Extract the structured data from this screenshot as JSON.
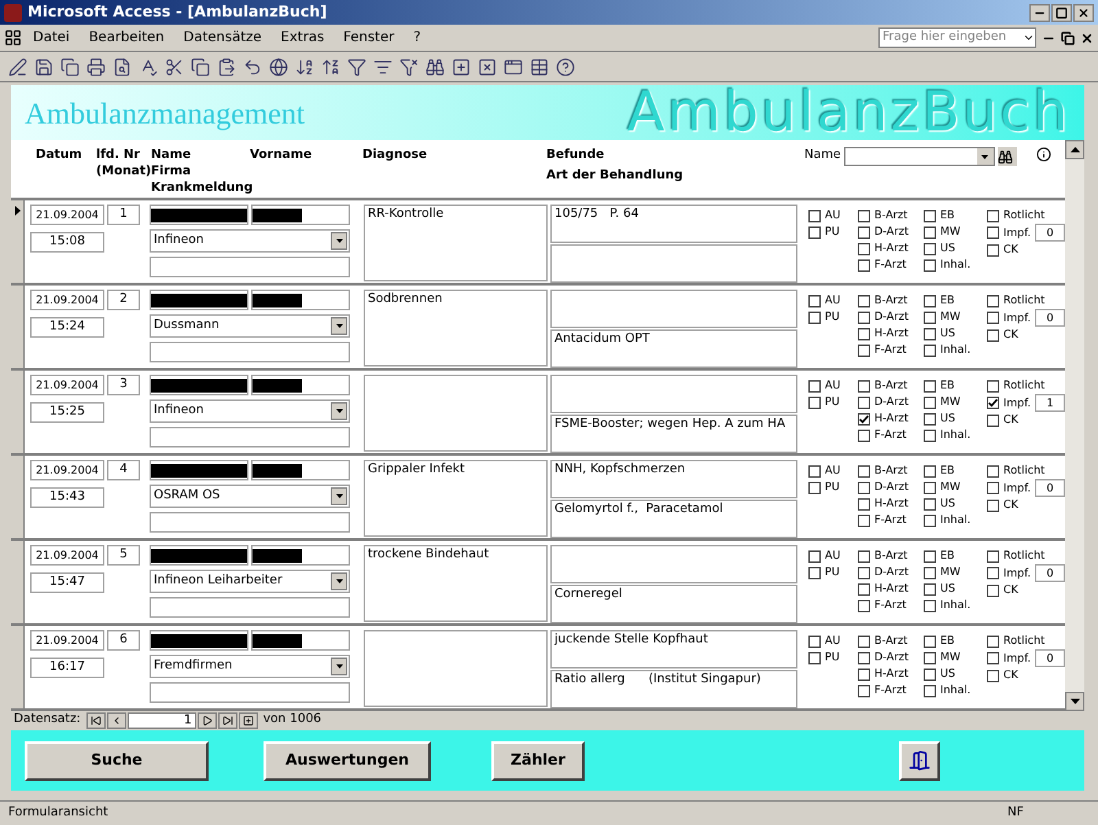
{
  "window": {
    "title": "Microsoft Access - [AmbulanzBuch]"
  },
  "menu": {
    "items": [
      "Datei",
      "Bearbeiten",
      "Datensätze",
      "Extras",
      "Fenster",
      "?"
    ],
    "help_placeholder": "Frage hier eingeben"
  },
  "form": {
    "heading": "Ambulanzmanagement",
    "logo_text": "AmbulanzBuch",
    "columns": {
      "datum": "Datum",
      "nr": "lfd. Nr",
      "nr_sub": "(Monat)",
      "name": "Name",
      "firma": "Firma",
      "krank": "Krankmeldung",
      "vorname": "Vorname",
      "diagnose": "Diagnose",
      "befunde": "Befunde",
      "behandlung": "Art der Behandlung"
    },
    "search_label": "Name",
    "rows": [
      {
        "current": true,
        "date": "21.09.2004",
        "nr": "1",
        "time": "15:08",
        "firma": "Infineon",
        "diagnose": "RR-Kontrolle",
        "befund": "105/75   P. 64",
        "behandlung": "",
        "impf": "0",
        "checks": [
          {
            "label": "AU",
            "checked": false
          },
          {
            "label": "PU",
            "checked": false
          },
          {
            "label": "B-Arzt",
            "checked": false
          },
          {
            "label": "D-Arzt",
            "checked": false
          },
          {
            "label": "H-Arzt",
            "checked": false
          },
          {
            "label": "F-Arzt",
            "checked": false
          },
          {
            "label": "EB",
            "checked": false
          },
          {
            "label": "MW",
            "checked": false
          },
          {
            "label": "US",
            "checked": false
          },
          {
            "label": "Inhal.",
            "checked": false
          },
          {
            "label": "Rotlicht",
            "checked": false
          },
          {
            "label": "Impf.",
            "checked": false
          },
          {
            "label": "CK",
            "checked": false
          }
        ]
      },
      {
        "current": false,
        "date": "21.09.2004",
        "nr": "2",
        "time": "15:24",
        "firma": "Dussmann",
        "diagnose": "Sodbrennen",
        "befund": "",
        "behandlung": "Antacidum OPT",
        "impf": "0",
        "checks": [
          {
            "label": "AU",
            "checked": false
          },
          {
            "label": "PU",
            "checked": false
          },
          {
            "label": "B-Arzt",
            "checked": false
          },
          {
            "label": "D-Arzt",
            "checked": false
          },
          {
            "label": "H-Arzt",
            "checked": false
          },
          {
            "label": "F-Arzt",
            "checked": false
          },
          {
            "label": "EB",
            "checked": false
          },
          {
            "label": "MW",
            "checked": false
          },
          {
            "label": "US",
            "checked": false
          },
          {
            "label": "Inhal.",
            "checked": false
          },
          {
            "label": "Rotlicht",
            "checked": false
          },
          {
            "label": "Impf.",
            "checked": false
          },
          {
            "label": "CK",
            "checked": false
          }
        ]
      },
      {
        "current": false,
        "date": "21.09.2004",
        "nr": "3",
        "time": "15:25",
        "firma": "Infineon",
        "diagnose": "",
        "befund": "",
        "behandlung": "FSME-Booster; wegen Hep. A zum HA",
        "impf": "1",
        "checks": [
          {
            "label": "AU",
            "checked": false
          },
          {
            "label": "PU",
            "checked": false
          },
          {
            "label": "B-Arzt",
            "checked": false
          },
          {
            "label": "D-Arzt",
            "checked": false
          },
          {
            "label": "H-Arzt",
            "checked": true
          },
          {
            "label": "F-Arzt",
            "checked": false
          },
          {
            "label": "EB",
            "checked": false
          },
          {
            "label": "MW",
            "checked": false
          },
          {
            "label": "US",
            "checked": false
          },
          {
            "label": "Inhal.",
            "checked": false
          },
          {
            "label": "Rotlicht",
            "checked": false
          },
          {
            "label": "Impf.",
            "checked": true
          },
          {
            "label": "CK",
            "checked": false
          }
        ]
      },
      {
        "current": false,
        "date": "21.09.2004",
        "nr": "4",
        "time": "15:43",
        "firma": "OSRAM OS",
        "diagnose": "Grippaler Infekt",
        "befund": "NNH, Kopfschmerzen",
        "behandlung": "Gelomyrtol f.,  Paracetamol",
        "impf": "0",
        "checks": [
          {
            "label": "AU",
            "checked": false
          },
          {
            "label": "PU",
            "checked": false
          },
          {
            "label": "B-Arzt",
            "checked": false
          },
          {
            "label": "D-Arzt",
            "checked": false
          },
          {
            "label": "H-Arzt",
            "checked": false
          },
          {
            "label": "F-Arzt",
            "checked": false
          },
          {
            "label": "EB",
            "checked": false
          },
          {
            "label": "MW",
            "checked": false
          },
          {
            "label": "US",
            "checked": false
          },
          {
            "label": "Inhal.",
            "checked": false
          },
          {
            "label": "Rotlicht",
            "checked": false
          },
          {
            "label": "Impf.",
            "checked": false
          },
          {
            "label": "CK",
            "checked": false
          }
        ]
      },
      {
        "current": false,
        "date": "21.09.2004",
        "nr": "5",
        "time": "15:47",
        "firma": "Infineon Leiharbeiter",
        "diagnose": "trockene Bindehaut",
        "befund": "",
        "behandlung": "Corneregel",
        "impf": "0",
        "checks": [
          {
            "label": "AU",
            "checked": false
          },
          {
            "label": "PU",
            "checked": false
          },
          {
            "label": "B-Arzt",
            "checked": false
          },
          {
            "label": "D-Arzt",
            "checked": false
          },
          {
            "label": "H-Arzt",
            "checked": false
          },
          {
            "label": "F-Arzt",
            "checked": false
          },
          {
            "label": "EB",
            "checked": false
          },
          {
            "label": "MW",
            "checked": false
          },
          {
            "label": "US",
            "checked": false
          },
          {
            "label": "Inhal.",
            "checked": false
          },
          {
            "label": "Rotlicht",
            "checked": false
          },
          {
            "label": "Impf.",
            "checked": false
          },
          {
            "label": "CK",
            "checked": false
          }
        ]
      },
      {
        "current": false,
        "date": "21.09.2004",
        "nr": "6",
        "time": "16:17",
        "firma": "Fremdfirmen",
        "diagnose": "",
        "befund": "juckende Stelle Kopfhaut",
        "behandlung": "Ratio allerg      (Institut Singapur)",
        "impf": "0",
        "checks": [
          {
            "label": "AU",
            "checked": false
          },
          {
            "label": "PU",
            "checked": false
          },
          {
            "label": "B-Arzt",
            "checked": false
          },
          {
            "label": "D-Arzt",
            "checked": false
          },
          {
            "label": "H-Arzt",
            "checked": false
          },
          {
            "label": "F-Arzt",
            "checked": false
          },
          {
            "label": "EB",
            "checked": false
          },
          {
            "label": "MW",
            "checked": false
          },
          {
            "label": "US",
            "checked": false
          },
          {
            "label": "Inhal.",
            "checked": false
          },
          {
            "label": "Rotlicht",
            "checked": false
          },
          {
            "label": "Impf.",
            "checked": false
          },
          {
            "label": "CK",
            "checked": false
          }
        ]
      }
    ],
    "navigation": {
      "label": "Datensatz:",
      "record": "1",
      "total": "von 1006"
    },
    "buttons": [
      "Suche",
      "Auswertungen",
      "Zähler"
    ]
  },
  "status_bar": {
    "text": "Formularansicht",
    "indicator": "NF"
  }
}
